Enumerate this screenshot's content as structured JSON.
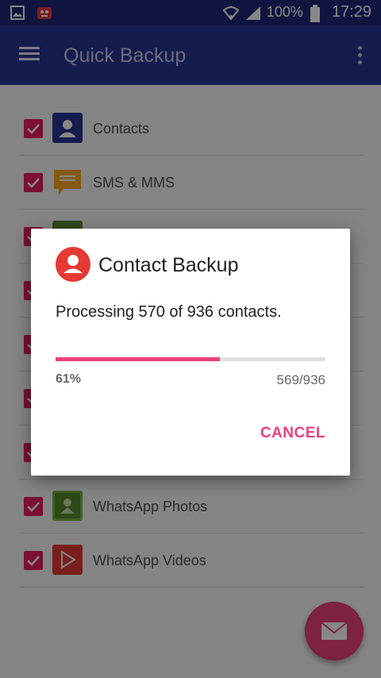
{
  "status_bar": {
    "battery": "100%",
    "time": "17:29"
  },
  "app_bar": {
    "title": "Quick Backup"
  },
  "list": {
    "items": [
      {
        "label": "Contacts",
        "icon": "contacts-icon",
        "checked": true
      },
      {
        "label": "SMS & MMS",
        "icon": "sms-icon",
        "checked": true
      },
      {
        "label": "",
        "icon": "generic-icon",
        "checked": true
      },
      {
        "label": "",
        "icon": "generic-icon",
        "checked": true
      },
      {
        "label": "",
        "icon": "generic-icon",
        "checked": true
      },
      {
        "label": "",
        "icon": "generic-icon",
        "checked": true
      },
      {
        "label": "",
        "icon": "generic-icon",
        "checked": true
      },
      {
        "label": "WhatsApp Photos",
        "icon": "whatsapp-photos-icon",
        "checked": true
      },
      {
        "label": "WhatsApp Videos",
        "icon": "whatsapp-videos-icon",
        "checked": true
      }
    ]
  },
  "dialog": {
    "title": "Contact Backup",
    "message": "Processing 570 of 936 contacts.",
    "progress_percent_label": "61%",
    "progress_fraction": 0.61,
    "progress_count": "569/936",
    "cancel_label": "CANCEL"
  },
  "colors": {
    "appbar": "#283593",
    "statusbar": "#1f2978",
    "accent": "#ec407a",
    "checkbox": "#e91e63"
  }
}
